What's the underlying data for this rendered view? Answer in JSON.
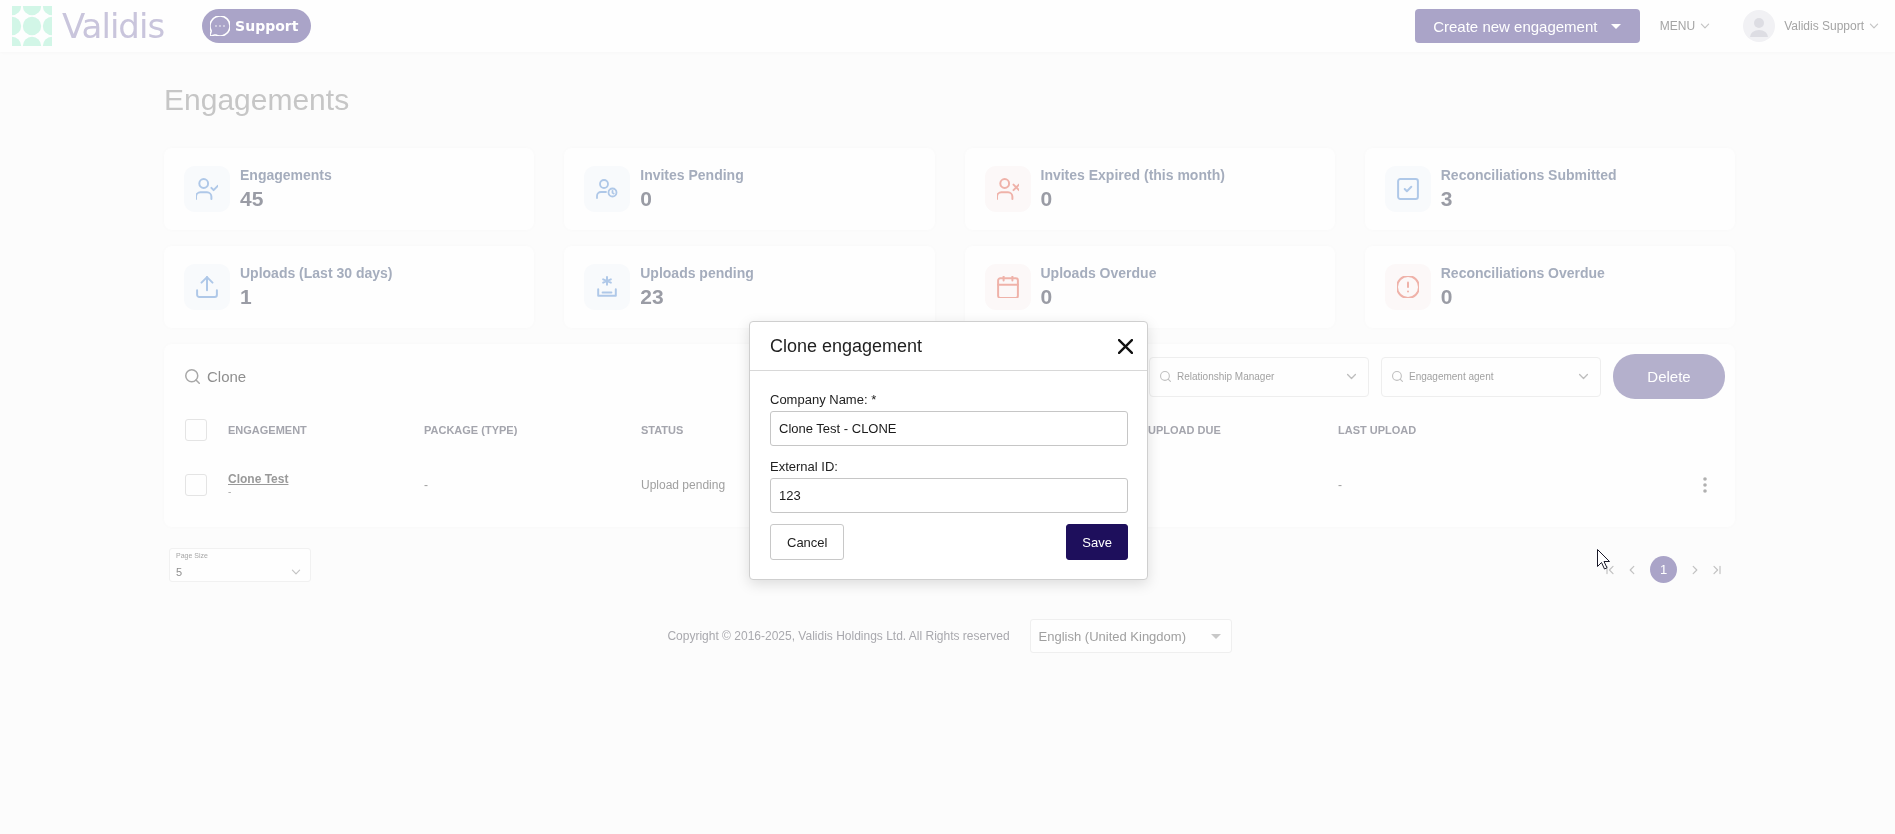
{
  "header": {
    "logo": "Validis",
    "support_button": "Support",
    "create_button": "Create new engagement",
    "menu": "MENU",
    "user": "Validis Support"
  },
  "page_title": "Engagements",
  "stats": [
    {
      "label": "Engagements",
      "value": "45",
      "warning": false
    },
    {
      "label": "Invites Pending",
      "value": "0",
      "warning": false
    },
    {
      "label": "Invites Expired (this month)",
      "value": "0",
      "warning": true
    },
    {
      "label": "Reconciliations Submitted",
      "value": "3",
      "warning": false
    },
    {
      "label": "Uploads (Last 30 days)",
      "value": "1",
      "warning": false
    },
    {
      "label": "Uploads pending",
      "value": "23",
      "warning": false
    },
    {
      "label": "Uploads Overdue",
      "value": "0",
      "warning": true
    },
    {
      "label": "Reconciliations Overdue",
      "value": "0",
      "warning": true
    }
  ],
  "table": {
    "search": {
      "value": "Clone"
    },
    "filters": [
      {
        "placeholder": "Relationship Manager"
      },
      {
        "placeholder": "Engagement agent"
      }
    ],
    "delete_button": {
      "label": "Delete",
      "disabled": true
    },
    "select_all": {
      "checked": false
    },
    "columns": [
      "ENGAGEMENT",
      "PACKAGE (TYPE)",
      "STATUS",
      "UPLOAD DUE",
      "LAST UPLOAD"
    ],
    "rows": [
      {
        "selected": false,
        "engagement": "Clone Test",
        "engagement_detail": "-",
        "package": "-",
        "status": "Upload pending",
        "last_upload": "-"
      }
    ]
  },
  "page_size": {
    "label": "Page Size",
    "value": "5"
  },
  "pagination": {
    "pages": [
      {
        "label": "1",
        "selected": true
      }
    ]
  },
  "footer": {
    "copyright": "Copyright © 2016-2025, Validis Holdings Ltd. All Rights reserved",
    "language": "English (United Kingdom)"
  },
  "modal": {
    "title": "Clone engagement",
    "fields": [
      {
        "label": "Company Name: *",
        "value": "Clone Test - CLONE"
      },
      {
        "label": "External ID:",
        "value": "123"
      }
    ],
    "buttons": [
      {
        "label": "Cancel",
        "kind": "secondary"
      },
      {
        "label": "Save",
        "kind": "primary"
      }
    ]
  }
}
